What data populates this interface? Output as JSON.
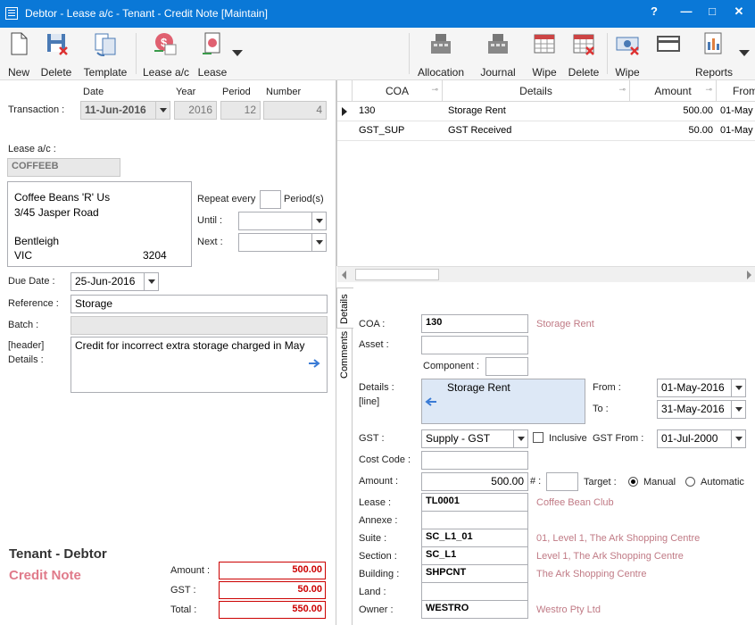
{
  "window": {
    "title": "Debtor - Lease a/c - Tenant - Credit Note [Maintain]",
    "help": "?",
    "minimize": "—",
    "maximize": "□",
    "close": "✕"
  },
  "toolbar": {
    "new": "New",
    "delete": "Delete",
    "template": "Template",
    "lease_ac": "Lease a/c",
    "lease": "Lease",
    "allocation": "Allocation",
    "journal": "Journal",
    "wipe": "Wipe",
    "delete2": "Delete",
    "wipe2": "Wipe",
    "reports": "Reports"
  },
  "transaction": {
    "label": "Transaction :",
    "date_hdr": "Date",
    "year_hdr": "Year",
    "period_hdr": "Period",
    "number_hdr": "Number",
    "date": "11-Jun-2016",
    "year": "2016",
    "period": "12",
    "number": "4"
  },
  "lease_ac": {
    "label": "Lease a/c :",
    "value": "COFFEEB"
  },
  "address": {
    "line1": "Coffee Beans 'R' Us",
    "line2": "3/45 Jasper Road",
    "line3": "",
    "city": "Bentleigh",
    "state": "VIC",
    "postcode": "3204"
  },
  "repeat": {
    "label": "Repeat every",
    "periods": "Period(s)",
    "until": "Until :",
    "next": "Next :"
  },
  "due_date": {
    "label": "Due Date :",
    "value": "25-Jun-2016"
  },
  "reference": {
    "label": "Reference :",
    "value": "Storage"
  },
  "batch": {
    "label": "Batch :"
  },
  "header_details": {
    "label1": "[header]",
    "label2": "Details :",
    "value": "Credit for incorrect extra storage charged in May"
  },
  "summary": {
    "heading": "Tenant - Debtor",
    "doc_type": "Credit Note",
    "amount_label": "Amount :",
    "gst_label": "GST :",
    "total_label": "Total :",
    "amount": "500.00",
    "gst": "50.00",
    "total": "550.00"
  },
  "grid": {
    "headers": [
      "COA",
      "Details",
      "Amount",
      "From"
    ],
    "rows": [
      {
        "coa": "130",
        "details": "Storage Rent",
        "amount": "500.00",
        "from": "01-May"
      },
      {
        "coa": "GST_SUP",
        "details": "GST Received",
        "amount": "50.00",
        "from": "01-May"
      }
    ]
  },
  "tabs": {
    "details": "Details",
    "comments": "Comments"
  },
  "line": {
    "coa_label": "COA :",
    "coa": "130",
    "coa_desc": "Storage Rent",
    "asset_label": "Asset :",
    "component_label": "Component :",
    "details_label1": "Details :",
    "details_label2": "[line]",
    "details": "Storage Rent",
    "from_label": "From :",
    "from": "01-May-2016",
    "to_label": "To :",
    "to": "31-May-2016",
    "gst_label": "GST :",
    "gst": "Supply - GST",
    "inclusive": "Inclusive",
    "gst_from_label": "GST From :",
    "gst_from": "01-Jul-2000",
    "cost_code_label": "Cost Code :",
    "amount_label": "Amount :",
    "amount": "500.00",
    "hash": "# :",
    "target_label": "Target :",
    "manual": "Manual",
    "automatic": "Automatic",
    "lease_label": "Lease :",
    "lease": "TL0001",
    "lease_desc": "Coffee Bean Club",
    "annexe_label": "Annexe :",
    "suite_label": "Suite :",
    "suite": "SC_L1_01",
    "suite_desc": "01, Level 1, The Ark Shopping Centre",
    "section_label": "Section :",
    "section": "SC_L1",
    "section_desc": "Level 1, The Ark Shopping Centre",
    "building_label": "Building :",
    "building": "SHPCNT",
    "building_desc": "The Ark Shopping Centre",
    "land_label": "Land :",
    "owner_label": "Owner :",
    "owner": "WESTRO",
    "owner_desc": "Westro Pty Ltd"
  }
}
